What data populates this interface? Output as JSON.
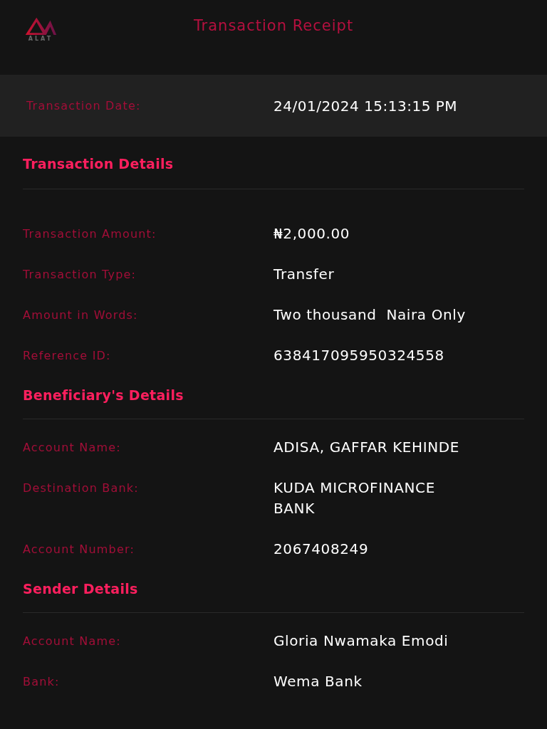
{
  "header": {
    "logo_text": "ALAT",
    "title": "Transaction Receipt"
  },
  "date_row": {
    "label": "Transaction Date:",
    "value": "24/01/2024 15:13:15 PM"
  },
  "sections": [
    {
      "heading": "Transaction Details",
      "rows": [
        {
          "label": "Transaction Amount:",
          "value": "₦2,000.00"
        },
        {
          "label": "Transaction Type:",
          "value": "Transfer"
        },
        {
          "label": "Amount in Words:",
          "value": "Two thousand  Naira Only"
        },
        {
          "label": "Reference ID:",
          "value": "638417095950324558"
        }
      ]
    },
    {
      "heading": "Beneficiary's Details",
      "rows": [
        {
          "label": "Account Name:",
          "value": "ADISA, GAFFAR KEHINDE"
        },
        {
          "label": "Destination Bank:",
          "value": "KUDA MICROFINANCE BANK"
        },
        {
          "label": "Account Number:",
          "value": "2067408249"
        }
      ]
    },
    {
      "heading": "Sender Details",
      "rows": [
        {
          "label": "Account Name:",
          "value": "Gloria Nwamaka Emodi"
        },
        {
          "label": "Bank:",
          "value": "Wema Bank"
        }
      ]
    }
  ]
}
